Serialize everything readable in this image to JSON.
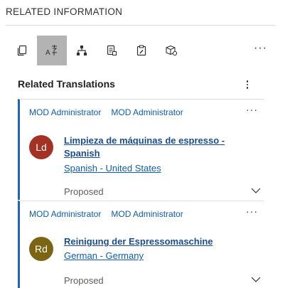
{
  "header": {
    "title": "RELATED INFORMATION"
  },
  "toolbar": {
    "buttons": [
      {
        "icon": "copy-icon",
        "active": false
      },
      {
        "icon": "translate-icon",
        "active": true
      },
      {
        "icon": "hierarchy-icon",
        "active": false
      },
      {
        "icon": "document-list-icon",
        "active": false
      },
      {
        "icon": "clipboard-edit-icon",
        "active": false
      },
      {
        "icon": "box-gear-icon",
        "active": false
      }
    ],
    "more": "···"
  },
  "section": {
    "title": "Related Translations"
  },
  "cards": [
    {
      "owner1": "MOD Administrator",
      "owner2": "MOD Administrator",
      "initials": "Ld",
      "avatar_color": "#a33225",
      "title": "Limpieza de máquinas de espresso - Spanish",
      "language": "Spanish - United States",
      "status": "Proposed",
      "more": "···"
    },
    {
      "owner1": "MOD Administrator",
      "owner2": "MOD Administrator",
      "initials": "Rd",
      "avatar_color": "#7b6512",
      "title": "Reinigung der Espressomaschine",
      "language": "German - Germany",
      "status": "Proposed",
      "more": "···"
    }
  ],
  "colors": {
    "accent": "#2266b3",
    "link": "#0f5cb0",
    "active_tab": "#b3b3b3"
  }
}
